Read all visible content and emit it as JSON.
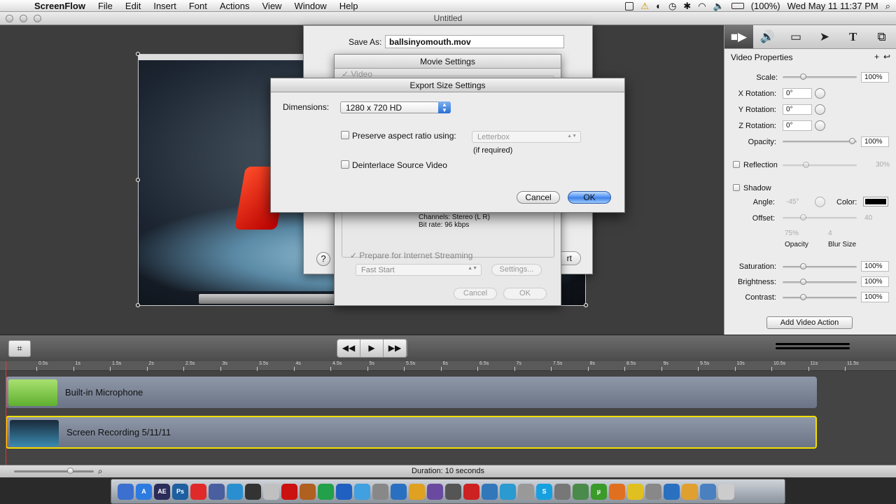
{
  "menubar": {
    "app_name": "ScreenFlow",
    "items": [
      "File",
      "Edit",
      "Insert",
      "Font",
      "Actions",
      "View",
      "Window",
      "Help"
    ],
    "battery": "(100%)",
    "clock": "Wed May 11  11:37 PM"
  },
  "window": {
    "title": "Untitled"
  },
  "save_sheet": {
    "save_as_label": "Save As:",
    "filename": "ballsinyomouth.mov",
    "help": "?",
    "export_label": "rt"
  },
  "movie_settings": {
    "title": "Movie Settings",
    "video_label": "Video",
    "channels": "Channels: Stereo (L R)",
    "bitrate": "Bit rate: 96 kbps",
    "prepare_label": "Prepare for Internet Streaming",
    "streaming_option": "Fast Start",
    "settings_button": "Settings...",
    "cancel": "Cancel",
    "ok": "OK"
  },
  "export_dialog": {
    "title": "Export Size Settings",
    "dimensions_label": "Dimensions:",
    "dimensions_value": "1280 x 720 HD",
    "preserve_label": "Preserve aspect ratio using:",
    "preserve_option": "Letterbox",
    "if_required": "(if required)",
    "deinterlace_label": "Deinterlace Source Video",
    "cancel": "Cancel",
    "ok": "OK"
  },
  "inspector": {
    "title": "Video Properties",
    "add": "+",
    "revert": "↩",
    "scale": {
      "label": "Scale:",
      "value": "100%"
    },
    "x_rotation": {
      "label": "X Rotation:",
      "value": "0°"
    },
    "y_rotation": {
      "label": "Y Rotation:",
      "value": "0°"
    },
    "z_rotation": {
      "label": "Z Rotation:",
      "value": "0°"
    },
    "opacity": {
      "label": "Opacity:",
      "value": "100%"
    },
    "reflection": {
      "label": "Reflection",
      "value": "30%"
    },
    "shadow": {
      "label": "Shadow",
      "angle_label": "Angle:",
      "angle": "-45°",
      "color_label": "Color:",
      "offset_label": "Offset:",
      "offset": "40",
      "opacity_value": "75%",
      "blur_value": "4",
      "opacity_label": "Opacity",
      "blur_label": "Blur Size"
    },
    "saturation": {
      "label": "Saturation:",
      "value": "100%"
    },
    "brightness": {
      "label": "Brightness:",
      "value": "100%"
    },
    "contrast": {
      "label": "Contrast:",
      "value": "100%"
    },
    "add_action": "Add Video Action"
  },
  "transport": {
    "rewind": "◀◀",
    "play": "▶",
    "forward": "▶▶"
  },
  "ruler": [
    "0.5s",
    "1s",
    "1.5s",
    "2s",
    "2.5s",
    "3s",
    "3.5s",
    "4s",
    "4.5s",
    "5s",
    "5.5s",
    "6s",
    "6.5s",
    "7s",
    "7.5s",
    "8s",
    "8.5s",
    "9s",
    "9.5s",
    "10s",
    "10.5s",
    "11s",
    "11.5s"
  ],
  "tracks": [
    {
      "name": "Built-in Microphone"
    },
    {
      "name": "Screen Recording 5/11/11"
    }
  ],
  "status": {
    "duration": "Duration: 10 seconds"
  },
  "dock": [
    {
      "label": "",
      "color": "#3b6fd0"
    },
    {
      "label": "A",
      "color": "#2d7be0"
    },
    {
      "label": "AE",
      "color": "#2c2c5a"
    },
    {
      "label": "Ps",
      "color": "#1d5fa0"
    },
    {
      "label": "",
      "color": "#e02a2a"
    },
    {
      "label": "",
      "color": "#4a5fa0"
    },
    {
      "label": "",
      "color": "#2a8fd0"
    },
    {
      "label": "",
      "color": "#333333"
    },
    {
      "label": "",
      "color": "#c0c0c0"
    },
    {
      "label": "",
      "color": "#cc1111"
    },
    {
      "label": "",
      "color": "#b06020"
    },
    {
      "label": "",
      "color": "#22a04a"
    },
    {
      "label": "",
      "color": "#2060c0"
    },
    {
      "label": "",
      "color": "#40a0e0"
    },
    {
      "label": "",
      "color": "#888888"
    },
    {
      "label": "",
      "color": "#2a70c0"
    },
    {
      "label": "",
      "color": "#e0a020"
    },
    {
      "label": "",
      "color": "#6a4aa0"
    },
    {
      "label": "",
      "color": "#555555"
    },
    {
      "label": "",
      "color": "#cc2222"
    },
    {
      "label": "",
      "color": "#3377bb"
    },
    {
      "label": "",
      "color": "#2a9ad0"
    },
    {
      "label": "",
      "color": "#999999"
    },
    {
      "label": "S",
      "color": "#17a0e0"
    },
    {
      "label": "",
      "color": "#777777"
    },
    {
      "label": "",
      "color": "#4a8a4a"
    },
    {
      "label": "µ",
      "color": "#3a9a2a"
    },
    {
      "label": "",
      "color": "#e07020"
    },
    {
      "label": "",
      "color": "#e0c020"
    },
    {
      "label": "",
      "color": "#888888"
    },
    {
      "label": "",
      "color": "#2a70c0"
    },
    {
      "label": "",
      "color": "#e0a030"
    },
    {
      "label": "",
      "color": "#4a80c0"
    },
    {
      "label": "",
      "color": "#cccccc"
    }
  ]
}
